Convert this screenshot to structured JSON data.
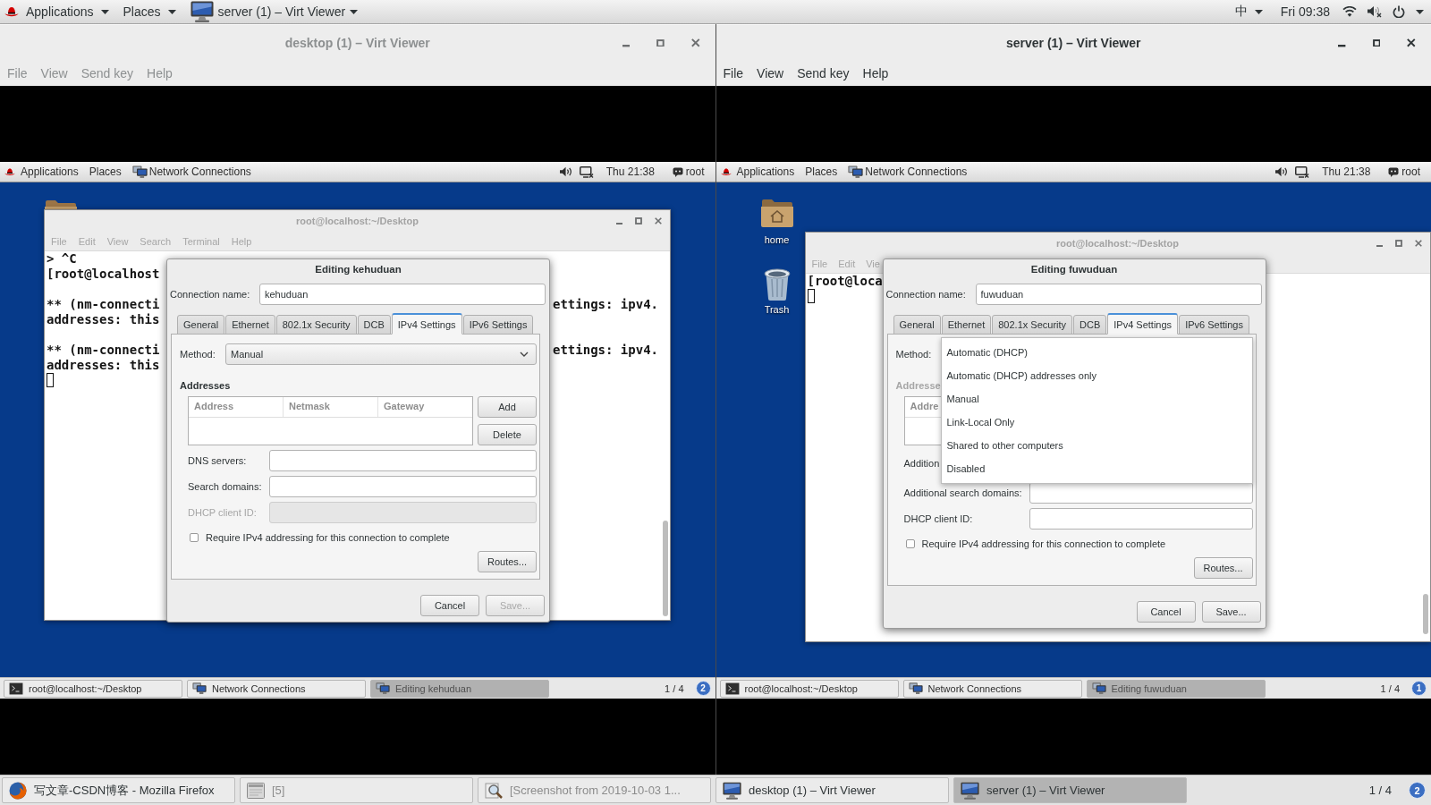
{
  "top_bar": {
    "menus": [
      "Applications",
      "Places"
    ],
    "window_menu": "server (1) – Virt Viewer",
    "input_method": "中",
    "clock": "Fri 09:38"
  },
  "viewers": [
    {
      "title": "desktop (1) – Virt Viewer",
      "active": false,
      "menu": [
        "File",
        "View",
        "Send key",
        "Help"
      ],
      "guest": {
        "panel": {
          "menus": [
            "Applications",
            "Places"
          ],
          "window": "Network Connections",
          "clock": "Thu 21:38",
          "user": "root"
        },
        "desktop_icons": [
          {
            "kind": "folder"
          }
        ],
        "terminal": {
          "title": "root@localhost:~/Desktop",
          "menu": [
            "File",
            "Edit",
            "View",
            "Search",
            "Terminal",
            "Help"
          ],
          "paragraphs": [
            [
              {
                "left": "> ^C"
              },
              {
                "left": "[root@localhost"
              }
            ],
            [
              {
                "left": "** (nm-connecti",
                "right": "ettings: ipv4."
              },
              {
                "left": "addresses: this"
              }
            ],
            [
              {
                "left": "** (nm-connecti",
                "right": "ettings: ipv4."
              },
              {
                "left": "addresses: this"
              }
            ]
          ]
        },
        "dialog": {
          "title": "Editing kehuduan",
          "connection_label": "Connection name:",
          "connection_name": "kehuduan",
          "tabs": [
            {
              "label": "General",
              "selected": false
            },
            {
              "label": "Ethernet",
              "selected": false
            },
            {
              "label": "802.1x Security",
              "selected": false
            },
            {
              "label": "DCB",
              "selected": false
            },
            {
              "label": "IPv4 Settings",
              "selected": true
            },
            {
              "label": "IPv6 Settings",
              "selected": false
            }
          ],
          "method": {
            "label": "Method:",
            "value": "Manual"
          },
          "addresses": {
            "label": "Addresses",
            "disabled": false,
            "columns": [
              "Address",
              "Netmask",
              "Gateway"
            ],
            "add_button": "Add",
            "delete_button": "Delete"
          },
          "fields": [
            {
              "label": "DNS servers:",
              "kind": "entry",
              "disabled": false
            },
            {
              "label": "Search domains:",
              "kind": "entry",
              "disabled": false
            },
            {
              "label": "DHCP client ID:",
              "kind": "entry",
              "disabled": true
            }
          ],
          "require": {
            "label": "Require IPv4 addressing for this connection to complete",
            "checked": false
          },
          "routes_button": "Routes...",
          "buttons": [
            {
              "label": "Cancel",
              "disabled": false
            },
            {
              "label": "Save...",
              "disabled": true
            }
          ]
        },
        "taskbar": {
          "items": [
            {
              "label": "root@localhost:~/Desktop",
              "kind": "terminal",
              "selected": false
            },
            {
              "label": "Network Connections",
              "kind": "network",
              "selected": false
            },
            {
              "label": "Editing kehuduan",
              "kind": "network",
              "selected": true
            }
          ],
          "workspace": "1 / 4",
          "notifications": "2"
        }
      }
    },
    {
      "title": "server (1) – Virt Viewer",
      "active": true,
      "menu": [
        "File",
        "View",
        "Send key",
        "Help"
      ],
      "guest": {
        "panel": {
          "menus": [
            "Applications",
            "Places"
          ],
          "window": "Network Connections",
          "clock": "Thu 21:38",
          "user": "root"
        },
        "desktop_icons": [
          {
            "kind": "home",
            "label": "home"
          },
          {
            "kind": "trash",
            "label": "Trash"
          }
        ],
        "terminal": {
          "title": "root@localhost:~/Desktop",
          "menu": [
            "File",
            "Edit",
            "Vie"
          ],
          "paragraphs": [
            [
              {
                "left": "[root@loca"
              }
            ]
          ]
        },
        "dialog": {
          "title": "Editing fuwuduan",
          "connection_label": "Connection name:",
          "connection_name": "fuwuduan",
          "tabs": [
            {
              "label": "General",
              "selected": false
            },
            {
              "label": "Ethernet",
              "selected": false
            },
            {
              "label": "802.1x Security",
              "selected": false
            },
            {
              "label": "DCB",
              "selected": false
            },
            {
              "label": "IPv4 Settings",
              "selected": true
            },
            {
              "label": "IPv6 Settings",
              "selected": false
            }
          ],
          "method": {
            "label": "Method:",
            "options": [
              "Automatic (DHCP)",
              "Automatic (DHCP) addresses only",
              "Manual",
              "Link-Local Only",
              "Shared to other computers",
              "Disabled"
            ]
          },
          "addresses": {
            "label": "Addresse",
            "disabled": true,
            "columns": [
              "Addre"
            ]
          },
          "fields": [
            {
              "label": "Addition",
              "kind": "label",
              "disabled": false
            },
            {
              "label": "Additional search domains:",
              "kind": "entry",
              "disabled": false
            },
            {
              "label": "DHCP client ID:",
              "kind": "entry",
              "disabled": false
            }
          ],
          "require": {
            "label": "Require IPv4 addressing for this connection to complete",
            "checked": false
          },
          "routes_button": "Routes...",
          "buttons": [
            {
              "label": "Cancel",
              "disabled": false
            },
            {
              "label": "Save...",
              "disabled": false
            }
          ]
        },
        "taskbar": {
          "items": [
            {
              "label": "root@localhost:~/Desktop",
              "kind": "terminal",
              "selected": false
            },
            {
              "label": "Network Connections",
              "kind": "network",
              "selected": false
            },
            {
              "label": "Editing fuwuduan",
              "kind": "network",
              "selected": true
            }
          ],
          "workspace": "1 / 4",
          "notifications": "1"
        }
      }
    }
  ],
  "taskbar": {
    "items": [
      {
        "label": "写文章-CSDN博客 - Mozilla Firefox",
        "kind": "browser",
        "selected": false,
        "minimized": false
      },
      {
        "label": "[5]",
        "kind": "window",
        "selected": false,
        "minimized": true
      },
      {
        "label": "[Screenshot from 2019-10-03 1...",
        "kind": "screenshot",
        "selected": false,
        "minimized": true
      },
      {
        "label": "desktop (1) – Virt Viewer",
        "kind": "viewer",
        "selected": false,
        "minimized": false
      },
      {
        "label": "server (1) – Virt Viewer",
        "kind": "viewer",
        "selected": true,
        "minimized": false
      }
    ],
    "workspace": "1 / 4",
    "notifications": "2"
  }
}
